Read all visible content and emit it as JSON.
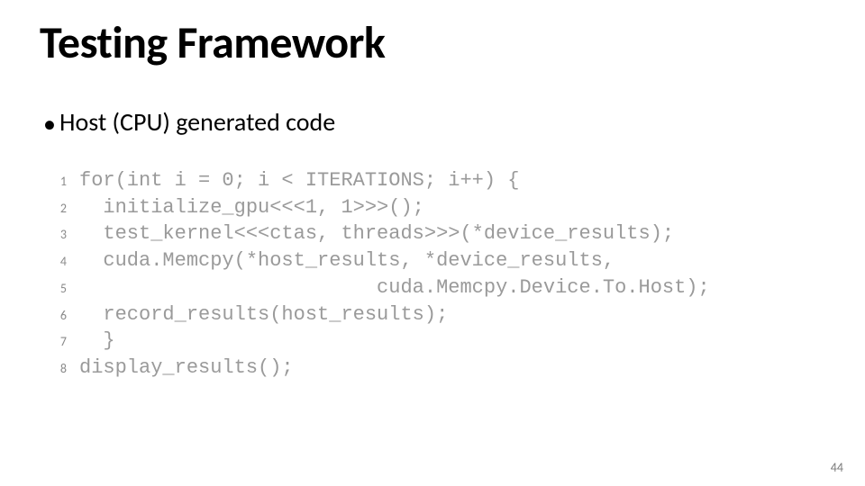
{
  "slide": {
    "title": "Testing Framework",
    "bullet": "Host (CPU) generated code",
    "bullet_marker": "•",
    "page_number": "44"
  },
  "code": {
    "lines": [
      {
        "n": "1",
        "text": "for(int i = 0; i < ITERATIONS; i++) {"
      },
      {
        "n": "2",
        "text": "  initialize_gpu<<<1, 1>>>();"
      },
      {
        "n": "3",
        "text": "  test_kernel<<<ctas, threads>>>(*device_results);"
      },
      {
        "n": "4",
        "text": "  cuda.Memcpy(*host_results, *device_results,"
      },
      {
        "n": "5",
        "text": "                         cuda.Memcpy.Device.To.Host);"
      },
      {
        "n": "6",
        "text": "  record_results(host_results);"
      },
      {
        "n": "7",
        "text": "  }"
      },
      {
        "n": "8",
        "text": "display_results();"
      }
    ]
  }
}
